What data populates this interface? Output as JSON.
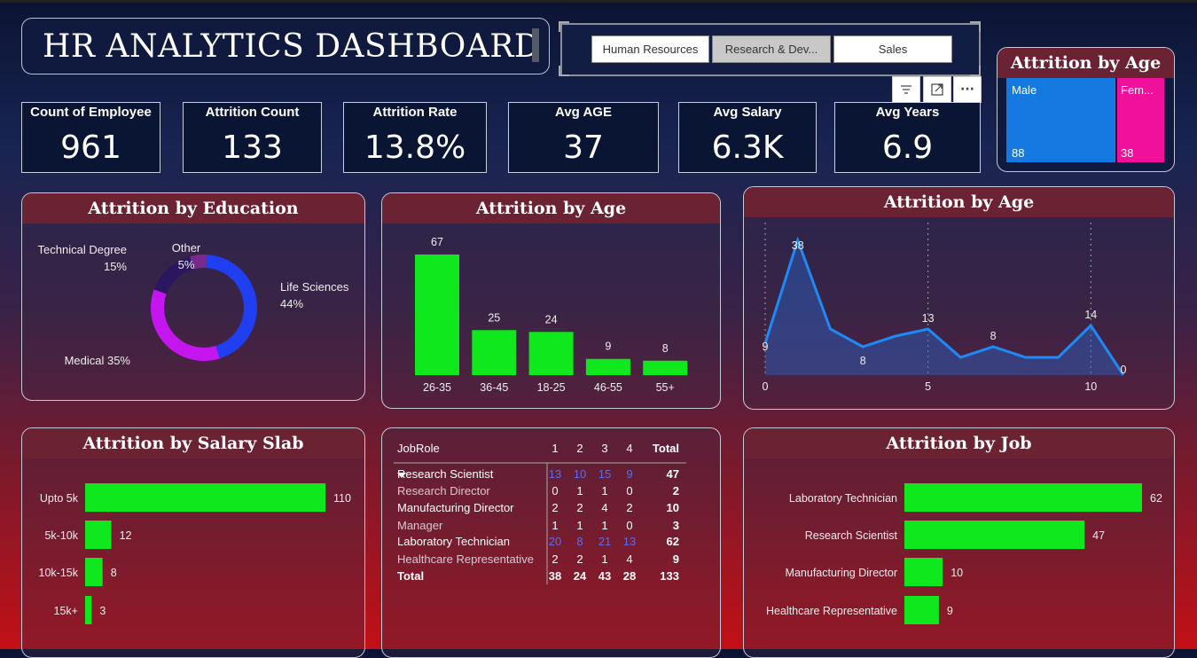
{
  "title": "HR ANALYTICS DASHBOARD",
  "slicer": {
    "options": [
      "Human Resources",
      "Research & Dev...",
      "Sales"
    ],
    "selected": "Research & Dev..."
  },
  "toolbar": {
    "filter_icon": "filter-icon",
    "focus_icon": "focus-mode-icon",
    "more_icon": "more-options-icon",
    "more_label": "···"
  },
  "kpis": [
    {
      "label": "Count of Employee",
      "value": "961"
    },
    {
      "label": "Attrition Count",
      "value": "133"
    },
    {
      "label": "Attrition Rate",
      "value": "13.8%"
    },
    {
      "label": "Avg AGE",
      "value": "37"
    },
    {
      "label": "Avg Salary",
      "value": "6.3K"
    },
    {
      "label": "Avg Years",
      "value": "6.9"
    }
  ],
  "gender": {
    "title": "Attrition by Age",
    "items": [
      {
        "label": "Male",
        "value": "88",
        "color": "#1479e0"
      },
      {
        "label": "Fem...",
        "value": "38",
        "color": "#f0109c"
      }
    ]
  },
  "education": {
    "title": "Attrition by Education"
  },
  "age_bar": {
    "title": "Attrition by Age"
  },
  "age_line": {
    "title": "Attrition by Age"
  },
  "salary": {
    "title": "Attrition by Salary Slab"
  },
  "job": {
    "title": "Attrition by Job"
  },
  "chart_data": [
    {
      "type": "pie",
      "title": "Attrition by Education",
      "categories": [
        "Life Sciences",
        "Medical",
        "Technical Degree",
        "Other"
      ],
      "values": [
        44,
        35,
        15,
        5
      ],
      "labels": [
        "44%",
        "35%",
        "15%",
        "5%"
      ],
      "colors": [
        "#1f3ff0",
        "#c616f0",
        "#2a1760",
        "#7a2a8c"
      ]
    },
    {
      "type": "bar",
      "title": "Attrition by Age",
      "categories": [
        "26-35",
        "36-45",
        "18-25",
        "46-55",
        "55+"
      ],
      "values": [
        67,
        25,
        24,
        9,
        8
      ],
      "color": "#0ee81c"
    },
    {
      "type": "area",
      "title": "Attrition by Age",
      "x": [
        0,
        1,
        2,
        3,
        4,
        5,
        6,
        7,
        8,
        9,
        10,
        11
      ],
      "y": [
        9,
        38,
        13,
        8,
        11,
        13,
        5,
        8,
        5,
        5,
        14,
        0
      ],
      "data_labels": [
        {
          "x": 0,
          "y": 9
        },
        {
          "x": 1,
          "y": 38
        },
        {
          "x": 3,
          "y": 8
        },
        {
          "x": 5,
          "y": 13
        },
        {
          "x": 7,
          "y": 8
        },
        {
          "x": 10,
          "y": 14
        },
        {
          "x": 11,
          "y": 0
        }
      ],
      "x_ticks": [
        "0",
        "5",
        "10"
      ],
      "x_tick_values": [
        0,
        5,
        10
      ],
      "ylim": [
        0,
        40
      ],
      "color": "#1e8af5"
    },
    {
      "type": "bar",
      "orientation": "horizontal",
      "title": "Attrition by Salary Slab",
      "categories": [
        "Upto 5k",
        "5k-10k",
        "10k-15k",
        "15k+"
      ],
      "values": [
        110,
        12,
        8,
        3
      ],
      "color": "#0ee81c"
    },
    {
      "type": "table",
      "columns": [
        "JobRole",
        "1",
        "2",
        "3",
        "4",
        "Total"
      ],
      "rows": [
        [
          "Research Scientist",
          "13",
          "10",
          "15",
          "9",
          "47"
        ],
        [
          "Research Director",
          "0",
          "1",
          "1",
          "0",
          "2"
        ],
        [
          "Manufacturing Director",
          "2",
          "2",
          "4",
          "2",
          "10"
        ],
        [
          "Manager",
          "1",
          "1",
          "1",
          "0",
          "3"
        ],
        [
          "Laboratory Technician",
          "20",
          "8",
          "21",
          "13",
          "62"
        ],
        [
          "Healthcare Representative",
          "2",
          "2",
          "1",
          "4",
          "9"
        ]
      ],
      "total_row": [
        "Total",
        "38",
        "24",
        "43",
        "28",
        "133"
      ]
    },
    {
      "type": "bar",
      "orientation": "horizontal",
      "title": "Attrition by Job",
      "categories": [
        "Laboratory Technician",
        "Research Scientist",
        "Manufacturing Director",
        "Healthcare Representative"
      ],
      "values": [
        62,
        47,
        10,
        9
      ],
      "color": "#0ee81c"
    }
  ]
}
